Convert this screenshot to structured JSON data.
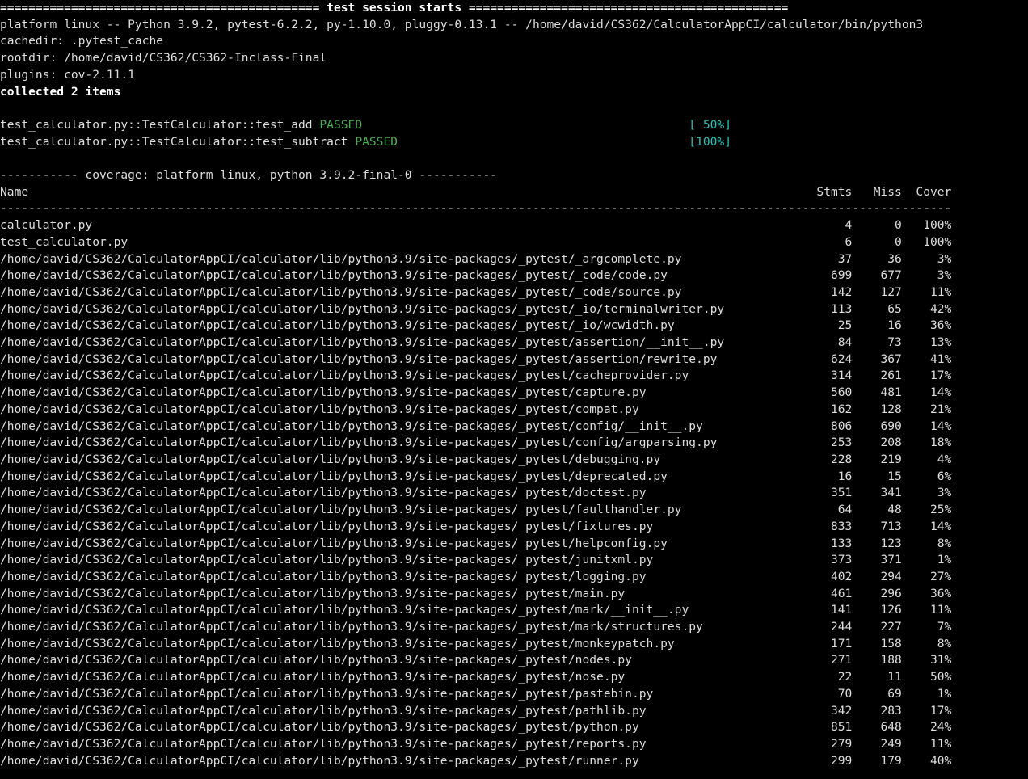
{
  "header": {
    "session_line": "============================================= test session starts =============================================",
    "platform": "platform linux -- Python 3.9.2, pytest-6.2.2, py-1.10.0, pluggy-0.13.1 -- /home/david/CS362/CalculatorAppCI/calculator/bin/python3",
    "cachedir": "cachedir: .pytest_cache",
    "rootdir": "rootdir: /home/david/CS362/CS362-Inclass-Final",
    "plugins": "plugins: cov-2.11.1",
    "collected": "collected 2 items"
  },
  "tests": [
    {
      "name": "test_calculator.py::TestCalculator::test_add ",
      "status": "PASSED",
      "progress": "[ 50%]"
    },
    {
      "name": "test_calculator.py::TestCalculator::test_subtract ",
      "status": "PASSED",
      "progress": "[100%]"
    }
  ],
  "test_name_col_width": 97,
  "coverage": {
    "banner": "----------- coverage: platform linux, python 3.9.2-final-0 -----------",
    "columns": {
      "name": "Name",
      "stmts": "Stmts",
      "miss": "Miss",
      "cover": "Cover"
    },
    "name_col_width": 113,
    "num_col_width": 7,
    "dash_count": 134,
    "rows": [
      {
        "name": "calculator.py",
        "stmts": 4,
        "miss": 0,
        "cover": "100%"
      },
      {
        "name": "test_calculator.py",
        "stmts": 6,
        "miss": 0,
        "cover": "100%"
      },
      {
        "name": "/home/david/CS362/CalculatorAppCI/calculator/lib/python3.9/site-packages/_pytest/_argcomplete.py",
        "stmts": 37,
        "miss": 36,
        "cover": "3%"
      },
      {
        "name": "/home/david/CS362/CalculatorAppCI/calculator/lib/python3.9/site-packages/_pytest/_code/code.py",
        "stmts": 699,
        "miss": 677,
        "cover": "3%"
      },
      {
        "name": "/home/david/CS362/CalculatorAppCI/calculator/lib/python3.9/site-packages/_pytest/_code/source.py",
        "stmts": 142,
        "miss": 127,
        "cover": "11%"
      },
      {
        "name": "/home/david/CS362/CalculatorAppCI/calculator/lib/python3.9/site-packages/_pytest/_io/terminalwriter.py",
        "stmts": 113,
        "miss": 65,
        "cover": "42%"
      },
      {
        "name": "/home/david/CS362/CalculatorAppCI/calculator/lib/python3.9/site-packages/_pytest/_io/wcwidth.py",
        "stmts": 25,
        "miss": 16,
        "cover": "36%"
      },
      {
        "name": "/home/david/CS362/CalculatorAppCI/calculator/lib/python3.9/site-packages/_pytest/assertion/__init__.py",
        "stmts": 84,
        "miss": 73,
        "cover": "13%"
      },
      {
        "name": "/home/david/CS362/CalculatorAppCI/calculator/lib/python3.9/site-packages/_pytest/assertion/rewrite.py",
        "stmts": 624,
        "miss": 367,
        "cover": "41%"
      },
      {
        "name": "/home/david/CS362/CalculatorAppCI/calculator/lib/python3.9/site-packages/_pytest/cacheprovider.py",
        "stmts": 314,
        "miss": 261,
        "cover": "17%"
      },
      {
        "name": "/home/david/CS362/CalculatorAppCI/calculator/lib/python3.9/site-packages/_pytest/capture.py",
        "stmts": 560,
        "miss": 481,
        "cover": "14%"
      },
      {
        "name": "/home/david/CS362/CalculatorAppCI/calculator/lib/python3.9/site-packages/_pytest/compat.py",
        "stmts": 162,
        "miss": 128,
        "cover": "21%"
      },
      {
        "name": "/home/david/CS362/CalculatorAppCI/calculator/lib/python3.9/site-packages/_pytest/config/__init__.py",
        "stmts": 806,
        "miss": 690,
        "cover": "14%"
      },
      {
        "name": "/home/david/CS362/CalculatorAppCI/calculator/lib/python3.9/site-packages/_pytest/config/argparsing.py",
        "stmts": 253,
        "miss": 208,
        "cover": "18%"
      },
      {
        "name": "/home/david/CS362/CalculatorAppCI/calculator/lib/python3.9/site-packages/_pytest/debugging.py",
        "stmts": 228,
        "miss": 219,
        "cover": "4%"
      },
      {
        "name": "/home/david/CS362/CalculatorAppCI/calculator/lib/python3.9/site-packages/_pytest/deprecated.py",
        "stmts": 16,
        "miss": 15,
        "cover": "6%"
      },
      {
        "name": "/home/david/CS362/CalculatorAppCI/calculator/lib/python3.9/site-packages/_pytest/doctest.py",
        "stmts": 351,
        "miss": 341,
        "cover": "3%"
      },
      {
        "name": "/home/david/CS362/CalculatorAppCI/calculator/lib/python3.9/site-packages/_pytest/faulthandler.py",
        "stmts": 64,
        "miss": 48,
        "cover": "25%"
      },
      {
        "name": "/home/david/CS362/CalculatorAppCI/calculator/lib/python3.9/site-packages/_pytest/fixtures.py",
        "stmts": 833,
        "miss": 713,
        "cover": "14%"
      },
      {
        "name": "/home/david/CS362/CalculatorAppCI/calculator/lib/python3.9/site-packages/_pytest/helpconfig.py",
        "stmts": 133,
        "miss": 123,
        "cover": "8%"
      },
      {
        "name": "/home/david/CS362/CalculatorAppCI/calculator/lib/python3.9/site-packages/_pytest/junitxml.py",
        "stmts": 373,
        "miss": 371,
        "cover": "1%"
      },
      {
        "name": "/home/david/CS362/CalculatorAppCI/calculator/lib/python3.9/site-packages/_pytest/logging.py",
        "stmts": 402,
        "miss": 294,
        "cover": "27%"
      },
      {
        "name": "/home/david/CS362/CalculatorAppCI/calculator/lib/python3.9/site-packages/_pytest/main.py",
        "stmts": 461,
        "miss": 296,
        "cover": "36%"
      },
      {
        "name": "/home/david/CS362/CalculatorAppCI/calculator/lib/python3.9/site-packages/_pytest/mark/__init__.py",
        "stmts": 141,
        "miss": 126,
        "cover": "11%"
      },
      {
        "name": "/home/david/CS362/CalculatorAppCI/calculator/lib/python3.9/site-packages/_pytest/mark/structures.py",
        "stmts": 244,
        "miss": 227,
        "cover": "7%"
      },
      {
        "name": "/home/david/CS362/CalculatorAppCI/calculator/lib/python3.9/site-packages/_pytest/monkeypatch.py",
        "stmts": 171,
        "miss": 158,
        "cover": "8%"
      },
      {
        "name": "/home/david/CS362/CalculatorAppCI/calculator/lib/python3.9/site-packages/_pytest/nodes.py",
        "stmts": 271,
        "miss": 188,
        "cover": "31%"
      },
      {
        "name": "/home/david/CS362/CalculatorAppCI/calculator/lib/python3.9/site-packages/_pytest/nose.py",
        "stmts": 22,
        "miss": 11,
        "cover": "50%"
      },
      {
        "name": "/home/david/CS362/CalculatorAppCI/calculator/lib/python3.9/site-packages/_pytest/pastebin.py",
        "stmts": 70,
        "miss": 69,
        "cover": "1%"
      },
      {
        "name": "/home/david/CS362/CalculatorAppCI/calculator/lib/python3.9/site-packages/_pytest/pathlib.py",
        "stmts": 342,
        "miss": 283,
        "cover": "17%"
      },
      {
        "name": "/home/david/CS362/CalculatorAppCI/calculator/lib/python3.9/site-packages/_pytest/python.py",
        "stmts": 851,
        "miss": 648,
        "cover": "24%"
      },
      {
        "name": "/home/david/CS362/CalculatorAppCI/calculator/lib/python3.9/site-packages/_pytest/reports.py",
        "stmts": 279,
        "miss": 249,
        "cover": "11%"
      },
      {
        "name": "/home/david/CS362/CalculatorAppCI/calculator/lib/python3.9/site-packages/_pytest/runner.py",
        "stmts": 299,
        "miss": 179,
        "cover": "40%"
      }
    ]
  }
}
